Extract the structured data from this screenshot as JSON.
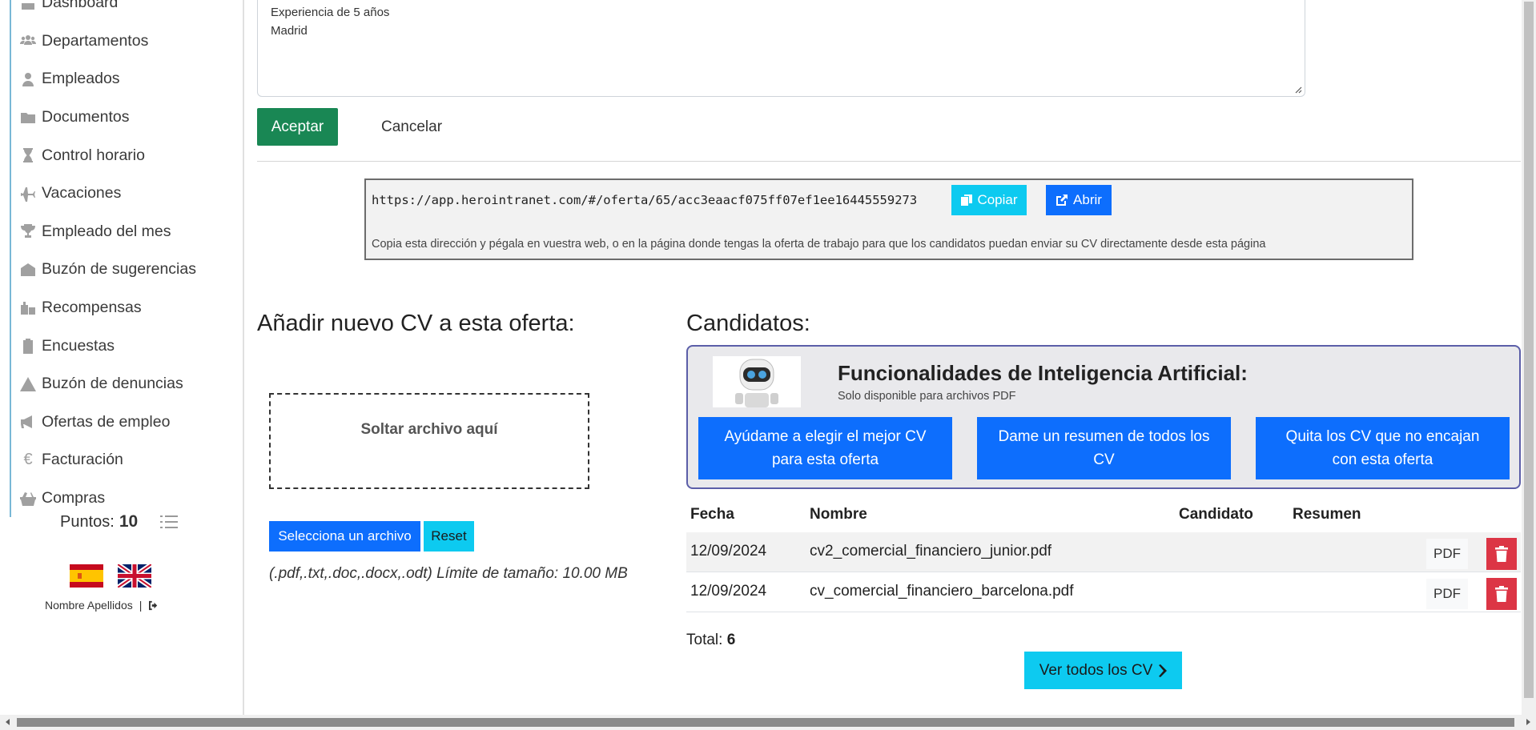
{
  "sidebar": {
    "items": [
      {
        "label": "Dashboard",
        "icon": "dashboard-icon"
      },
      {
        "label": "Departamentos",
        "icon": "users-icon"
      },
      {
        "label": "Empleados",
        "icon": "user-icon"
      },
      {
        "label": "Documentos",
        "icon": "folder-icon"
      },
      {
        "label": "Control horario",
        "icon": "hourglass-icon"
      },
      {
        "label": "Vacaciones",
        "icon": "plane-icon"
      },
      {
        "label": "Empleado del mes",
        "icon": "trophy-icon"
      },
      {
        "label": "Buzón de sugerencias",
        "icon": "envelope-open-icon"
      },
      {
        "label": "Recompensas",
        "icon": "gifts-icon"
      },
      {
        "label": "Encuestas",
        "icon": "clipboard-icon"
      },
      {
        "label": "Buzón de denuncias",
        "icon": "warning-icon"
      },
      {
        "label": "Ofertas de empleo",
        "icon": "megaphone-icon"
      },
      {
        "label": "Facturación",
        "icon": "euro-icon"
      },
      {
        "label": "Compras",
        "icon": "basket-icon"
      }
    ],
    "points_label": "Puntos:",
    "points_value": "10",
    "user_name": "Nombre Apellidos",
    "separator": "|"
  },
  "form": {
    "textarea_lines": [
      "Experiencia de 5 años",
      "Madrid"
    ],
    "accept_label": "Aceptar",
    "cancel_label": "Cancelar"
  },
  "share": {
    "url": "https://app.herointranet.com/#/oferta/65/acc3eaacf075ff07ef1ee16445559273",
    "copy_label": "Copiar",
    "open_label": "Abrir",
    "help": "Copia esta dirección y pégala en vuestra web, o en la página donde tengas la oferta de trabajo para que los candidatos puedan enviar su CV directamente desde esta página"
  },
  "upload": {
    "title": "Añadir nuevo CV a esta oferta:",
    "dropzone": "Soltar archivo aquí",
    "select_label": "Selecciona un archivo",
    "reset_label": "Reset",
    "hint": "(.pdf,.txt,.doc,.docx,.odt) Límite de tamaño: 10.00 MB"
  },
  "candidates": {
    "title": "Candidatos:",
    "ai": {
      "title": "Funcionalidades de Inteligencia Artificial:",
      "subtitle": "Solo disponible para archivos PDF",
      "buttons": [
        "Ayúdame a elegir el mejor CV para esta oferta",
        "Dame un resumen de todos los CV",
        "Quita los CV que no encajan con esta oferta"
      ]
    },
    "columns": [
      "Fecha",
      "Nombre",
      "Candidato",
      "Resumen"
    ],
    "rows": [
      {
        "fecha": "12/09/2024",
        "nombre": "cv2_comercial_financiero_junior.pdf",
        "pdf": "PDF"
      },
      {
        "fecha": "12/09/2024",
        "nombre": "cv_comercial_financiero_barcelona.pdf",
        "pdf": "PDF"
      }
    ],
    "total_label": "Total:",
    "total_value": "6",
    "view_all_label": "Ver todos los CV"
  },
  "colors": {
    "primary": "#0d6efd",
    "info": "#0dcaf0",
    "success": "#198754",
    "danger": "#dc3545",
    "ai_border": "#5b5ea8"
  }
}
